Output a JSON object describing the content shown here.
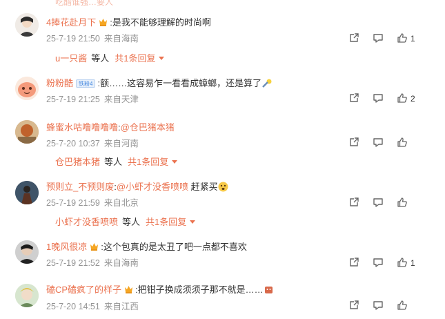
{
  "top_partial": "吃醋谁强…要人",
  "comments": [
    {
      "username": "4捧花赴月下",
      "has_crown": true,
      "badge": null,
      "text_parts": [
        ":是我不能够理解的时尚啊"
      ],
      "date": "25-7-19 21:50",
      "location": "来自海南",
      "likes": "1",
      "reply": {
        "name": "u一只酱",
        "etc": "等人",
        "more": "共1条回复"
      }
    },
    {
      "username": "粉粉酷",
      "has_crown": false,
      "badge": "铁粉4",
      "text_parts": [
        ":额……这容易乍一看看成蟑螂，还是算了"
      ],
      "date": "25-7-19 21:25",
      "location": "来自天津",
      "likes": "2",
      "reply": null
    },
    {
      "username": "蜂蜜水咕噜噜噜噜",
      "has_crown": false,
      "badge": null,
      "text_parts": [
        ":"
      ],
      "mention": "@仓巴猪本猪",
      "date": "25-7-20 10:37",
      "location": "来自河南",
      "likes": "",
      "reply": {
        "name": "仓巴猪本猪",
        "etc": "等人",
        "more": "共1条回复"
      }
    },
    {
      "username": "预则立_不预则废",
      "has_crown": false,
      "badge": null,
      "text_parts": [
        ":"
      ],
      "mention": "@小虾才没香喷喷",
      "after_mention": " 赶紧买",
      "date": "25-7-19 21:59",
      "location": "来自北京",
      "likes": "",
      "reply": {
        "name": "小虾才没香喷喷",
        "etc": "等人",
        "more": "共1条回复"
      }
    },
    {
      "username": "1晚风很凉",
      "has_crown": true,
      "badge": null,
      "text_parts": [
        ":这个包真的是太丑了吧一点都不喜欢"
      ],
      "date": "25-7-19 21:52",
      "location": "来自海南",
      "likes": "1",
      "reply": null
    },
    {
      "username": "磕CP磕疯了的样子",
      "has_crown": true,
      "badge": null,
      "text_parts": [
        ":把钳子换成须须子那不就是……"
      ],
      "date": "25-7-20 14:51",
      "location": "来自江西",
      "likes": "",
      "reply": null
    }
  ],
  "icons": {
    "share": "share-icon",
    "comment": "comment-icon",
    "like": "like-icon",
    "crown": "crown-icon"
  },
  "colors": {
    "accent": "#eb7350",
    "meta": "#939393",
    "text": "#333333"
  }
}
